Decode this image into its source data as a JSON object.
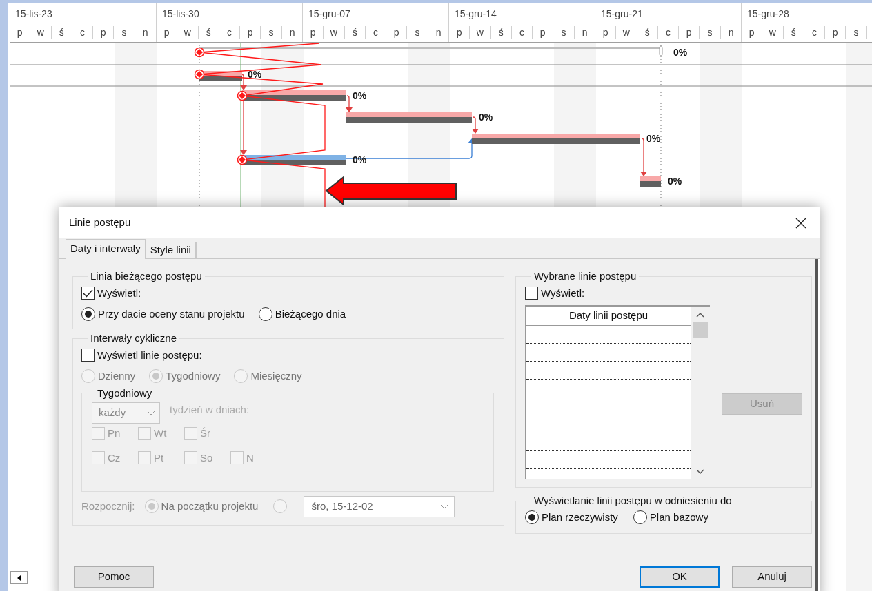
{
  "timeline": {
    "weeks": [
      {
        "label": "15-lis-23",
        "days": [
          "p",
          "w",
          "ś",
          "c",
          "p",
          "s",
          "n"
        ]
      },
      {
        "label": "15-lis-30",
        "days": [
          "p",
          "w",
          "ś",
          "c",
          "p",
          "s",
          "n"
        ]
      },
      {
        "label": "15-gru-07",
        "days": [
          "p",
          "w",
          "ś",
          "c",
          "p",
          "s",
          "n"
        ]
      },
      {
        "label": "15-gru-14",
        "days": [
          "p",
          "w",
          "ś",
          "c",
          "p",
          "s",
          "n"
        ]
      },
      {
        "label": "15-gru-21",
        "days": [
          "p",
          "w",
          "ś",
          "c",
          "p",
          "s",
          "n"
        ]
      },
      {
        "label": "15-gru-28",
        "days": [
          "p",
          "w",
          "ś",
          "c",
          "p",
          "s"
        ]
      }
    ]
  },
  "gantt": {
    "tasks": [
      {
        "kind": "summary",
        "label": "0%"
      },
      {
        "kind": "task",
        "critical": true,
        "label": "0%"
      },
      {
        "kind": "task",
        "critical": true,
        "label": "0%"
      },
      {
        "kind": "task",
        "critical": true,
        "label": "0%"
      },
      {
        "kind": "task",
        "critical": true,
        "label": "0%"
      },
      {
        "kind": "task",
        "critical": false,
        "label": "0%"
      },
      {
        "kind": "task",
        "critical": true,
        "label": "0%"
      }
    ]
  },
  "dialog": {
    "title": "Linie postępu",
    "tabs": [
      {
        "label": "Daty i interwały",
        "selected": true
      },
      {
        "label": "Style linii",
        "selected": false
      }
    ],
    "current_line": {
      "title": "Linia bieżącego postępu",
      "display": {
        "label": "Wyświetl:",
        "checked": true
      },
      "options": [
        {
          "label": "Przy dacie oceny stanu projektu",
          "selected": true
        },
        {
          "label": "Bieżącego dnia",
          "selected": false
        }
      ]
    },
    "recurring": {
      "title": "Interwały cykliczne",
      "display": {
        "label": "Wyświetl linie postępu:",
        "checked": false
      },
      "frequency": [
        {
          "label": "Dzienny",
          "selected": false,
          "disabled": true
        },
        {
          "label": "Tygodniowy",
          "selected": true,
          "disabled": true
        },
        {
          "label": "Miesięczny",
          "selected": false,
          "disabled": true
        }
      ],
      "weekly": {
        "title": "Tygodniowy",
        "every": {
          "value": "każdy",
          "disabled": true
        },
        "days_label": "tydzień w dniach:",
        "days": [
          {
            "label": "Pn",
            "checked": false,
            "disabled": true
          },
          {
            "label": "Wt",
            "checked": false,
            "disabled": true
          },
          {
            "label": "Śr",
            "checked": false,
            "disabled": true
          },
          {
            "label": "Cz",
            "checked": false,
            "disabled": true
          },
          {
            "label": "Pt",
            "checked": false,
            "disabled": true
          },
          {
            "label": "So",
            "checked": false,
            "disabled": true
          },
          {
            "label": "N",
            "checked": false,
            "disabled": true
          }
        ]
      },
      "start": {
        "label": "Rozpocznij:",
        "options": [
          {
            "label": "Na początku projektu",
            "selected": true,
            "disabled": true
          },
          {
            "selected": false,
            "disabled": true
          }
        ],
        "date": {
          "value": "śro, 15-12-02",
          "disabled": true
        }
      }
    },
    "selected_lines": {
      "title": "Wybrane linie postępu",
      "display": {
        "label": "Wyświetl:",
        "checked": false
      },
      "list": {
        "column": "Daty linii postępu"
      },
      "delete_button": {
        "label": "Usuń",
        "disabled": true
      }
    },
    "relative_to": {
      "title": "Wyświetlanie linii postępu w odniesieniu do",
      "options": [
        {
          "label": "Plan rzeczywisty",
          "selected": true
        },
        {
          "label": "Plan bazowy",
          "selected": false
        }
      ]
    },
    "buttons": [
      {
        "kind": "help",
        "label": "Pomoc"
      },
      {
        "kind": "default",
        "label": "OK"
      },
      {
        "kind": "cancel",
        "label": "Anuluj"
      }
    ]
  }
}
